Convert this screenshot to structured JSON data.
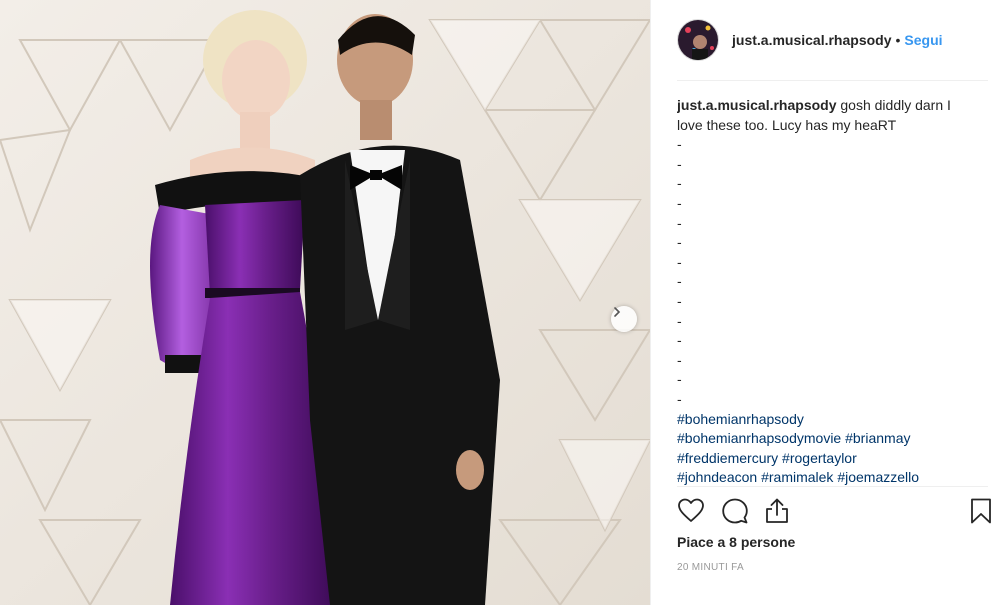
{
  "post": {
    "username": "just.a.musical.rhapsody",
    "separator": "•",
    "follow_label": "Segui",
    "caption_text": " gosh diddly darn I love these too. Lucy has my heaRT",
    "dashes": [
      "-",
      "-",
      "-",
      "-",
      "-",
      "-",
      "-",
      "-",
      "-",
      "-",
      "-",
      "-",
      "-",
      "-"
    ],
    "hashtags": [
      [
        "#bohemianrhapsody"
      ],
      [
        "#bohemianrhapsodymovie",
        "#brianmay"
      ],
      [
        "#freddiemercury",
        "#rogertaylor"
      ],
      [
        "#johndeacon",
        "#ramimalek",
        "#joemazzello"
      ]
    ],
    "likes_text": "Piace a 8 persone",
    "timestamp": "20 minuti fa"
  },
  "icons": {
    "like": "heart-icon",
    "comment": "comment-icon",
    "share": "share-icon",
    "save": "bookmark-icon",
    "next": "chevron-right-icon"
  },
  "colors": {
    "link": "#3897f0",
    "hashtag": "#003569",
    "dress": "#6a1f8c",
    "suit": "#121212",
    "wall": "#ece6de"
  }
}
